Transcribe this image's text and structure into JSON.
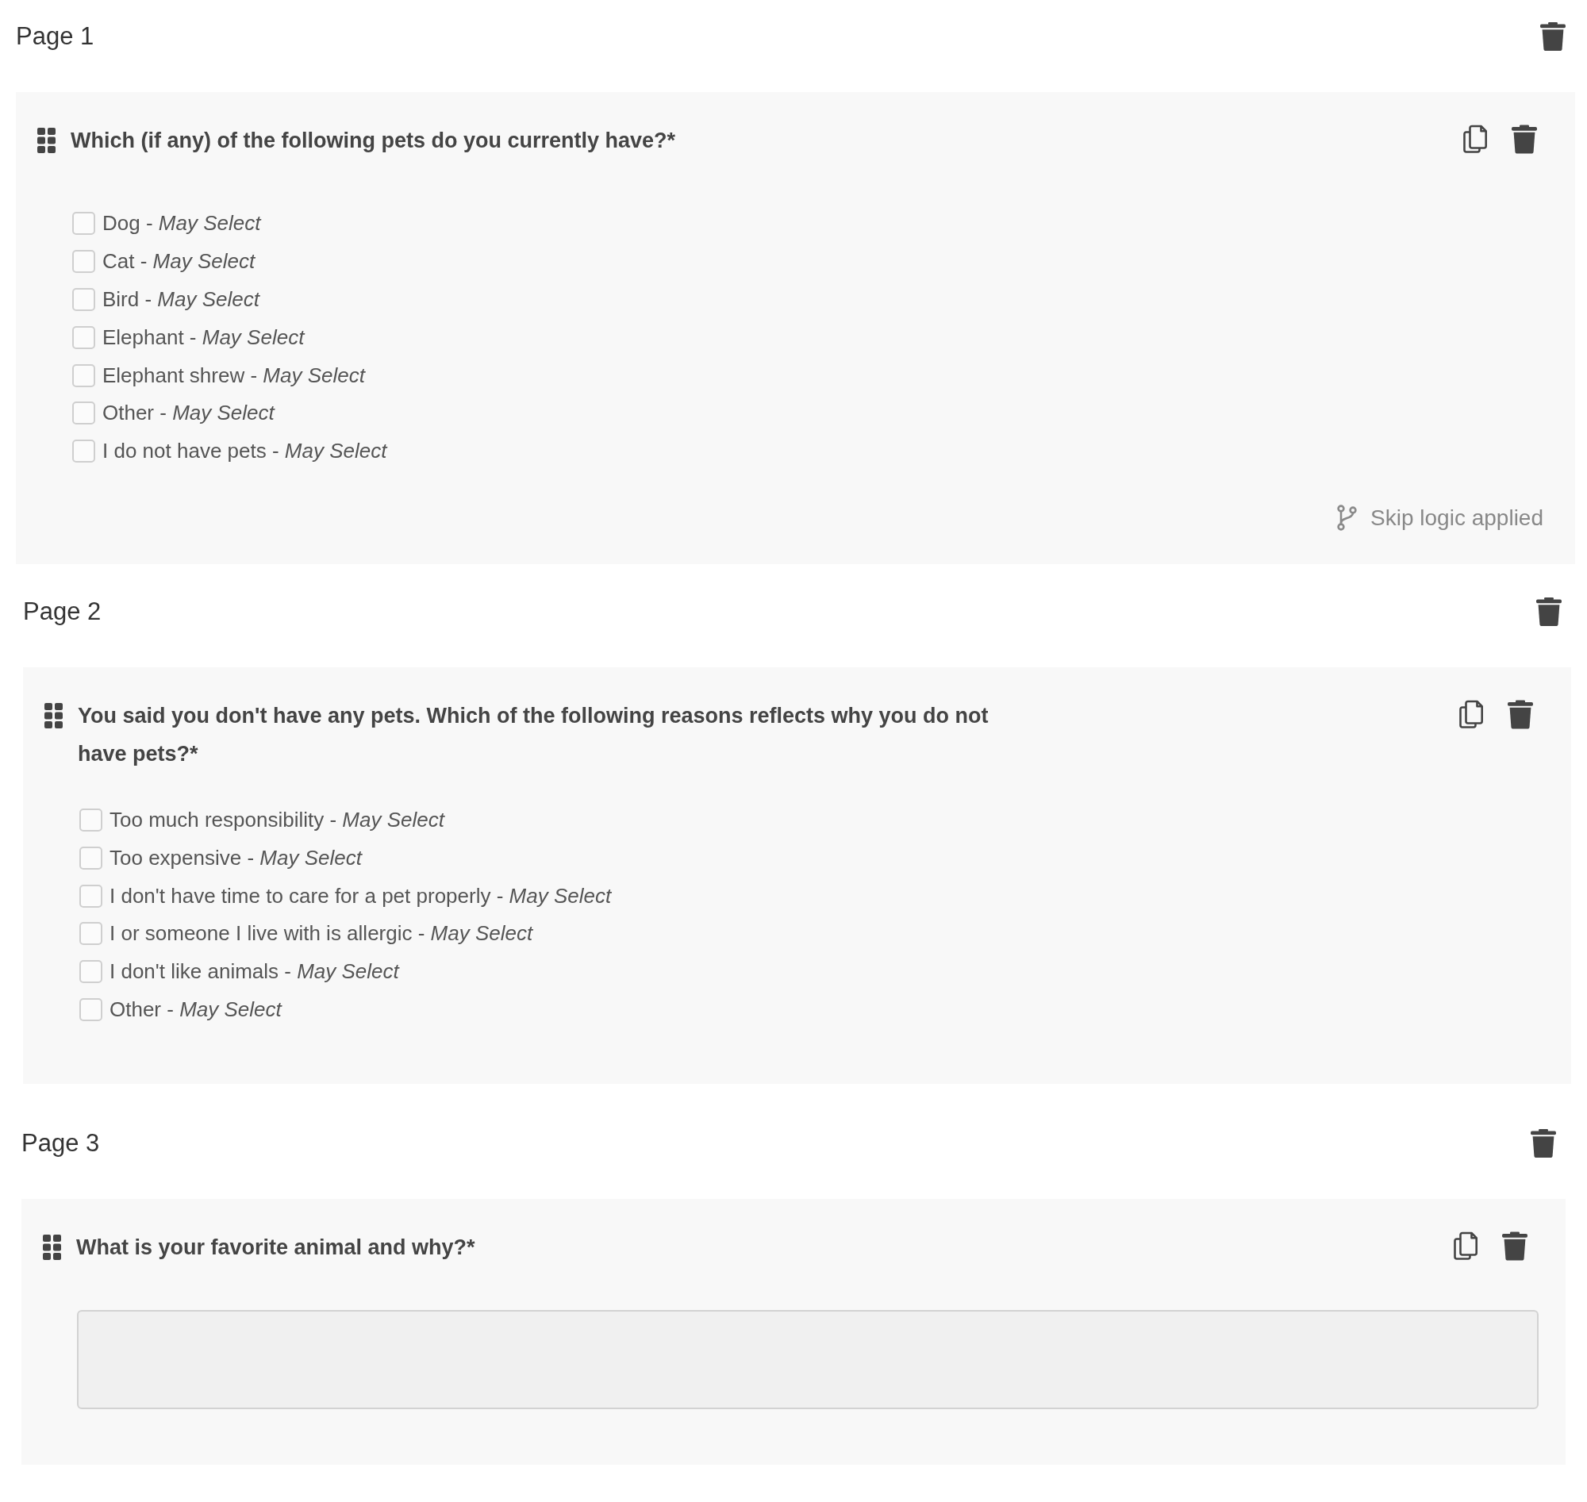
{
  "pages": [
    {
      "title": "Page 1",
      "questions": [
        {
          "kind": "checkbox",
          "text": "Which (if any) of the following pets do you currently have?*",
          "options": [
            {
              "label": "Dog - *May Select*",
              "checked": false
            },
            {
              "label": "Cat - *May Select*",
              "checked": false
            },
            {
              "label": "Bird - *May Select*",
              "checked": false
            },
            {
              "label": "Elephant - *May Select*",
              "checked": false
            },
            {
              "label": "Elephant shrew - *May Select*",
              "checked": false
            },
            {
              "label": "Other - *May Select*",
              "checked": false
            },
            {
              "label": "I do not have pets - *May Select*",
              "checked": false
            }
          ],
          "skip_logic": "Skip logic applied"
        }
      ]
    },
    {
      "title": "Page 2",
      "questions": [
        {
          "kind": "checkbox",
          "text": "You said you don't have any pets. Which of the following reasons reflects why you do not have pets?*",
          "options": [
            {
              "label": "Too much responsibility - *May Select*",
              "checked": false
            },
            {
              "label": "Too expensive - *May Select*",
              "checked": false
            },
            {
              "label": "I don't have time to care for a pet properly - *May Select*",
              "checked": false
            },
            {
              "label": "I or someone I live with is allergic - *May Select*",
              "checked": false
            },
            {
              "label": "I don't like animals - *May Select*",
              "checked": false
            },
            {
              "label": "Other - *May Select*",
              "checked": false
            }
          ]
        }
      ]
    },
    {
      "title": "Page 3",
      "questions": [
        {
          "kind": "text",
          "text": "What is your favorite animal and why?*"
        }
      ]
    }
  ]
}
